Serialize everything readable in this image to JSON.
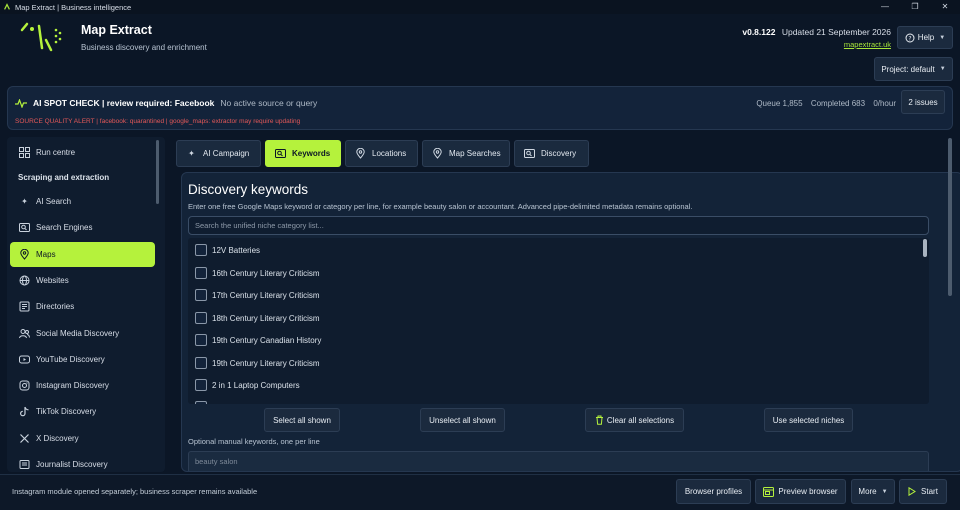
{
  "window": {
    "title": "Map Extract | Business intelligence",
    "controls": [
      "—",
      "❐",
      "✕"
    ]
  },
  "header": {
    "app_name": "Map Extract",
    "tagline": "Business discovery and enrichment",
    "version": "v0.8.122",
    "updated": "Updated 21 September 2026",
    "link": "mapextract.uk",
    "help_label": "Help",
    "project_label": "Project: default"
  },
  "alert": {
    "title": "AI SPOT CHECK | review required: Facebook",
    "status": "No active source or query",
    "quality": "SOURCE QUALITY ALERT | facebook: quarantined | google_maps: extractor may require updating",
    "queue": "Queue 1,855",
    "completed": "Completed 683",
    "rate": "0/hour",
    "issues_label": "2 issues"
  },
  "sidebar": {
    "run_centre": "Run centre",
    "section": "Scraping and extraction",
    "items": [
      {
        "label": "AI Search",
        "icon": "sparkle-icon"
      },
      {
        "label": "Search Engines",
        "icon": "search-engine-icon"
      },
      {
        "label": "Maps",
        "icon": "map-pin-icon",
        "active": true
      },
      {
        "label": "Websites",
        "icon": "globe-icon"
      },
      {
        "label": "Directories",
        "icon": "directory-icon"
      },
      {
        "label": "Social Media Discovery",
        "icon": "people-icon"
      },
      {
        "label": "YouTube Discovery",
        "icon": "youtube-icon"
      },
      {
        "label": "Instagram Discovery",
        "icon": "instagram-icon"
      },
      {
        "label": "TikTok Discovery",
        "icon": "tiktok-icon"
      },
      {
        "label": "X Discovery",
        "icon": "x-icon"
      },
      {
        "label": "Journalist Discovery",
        "icon": "journalist-icon"
      }
    ]
  },
  "tabs": [
    {
      "label": "AI Campaign",
      "icon": "sparkle-icon"
    },
    {
      "label": "Keywords",
      "icon": "keywords-icon",
      "active": true
    },
    {
      "label": "Locations",
      "icon": "map-pin-icon"
    },
    {
      "label": "Map Searches",
      "icon": "map-pin-icon"
    },
    {
      "label": "Discovery",
      "icon": "discovery-icon"
    }
  ],
  "keywords": {
    "title": "Discovery keywords",
    "description": "Enter one free Google Maps keyword or category per line, for example beauty salon or accountant. Advanced pipe-delimited metadata remains optional.",
    "search_placeholder": "Search the unified niche category list...",
    "items": [
      "12V Batteries",
      "16th Century Literary Criticism",
      "17th Century Literary Criticism",
      "18th Century Literary Criticism",
      "19th Century Canadian History",
      "19th Century Literary Criticism",
      "2 in 1 Laptop Computers"
    ],
    "select_all": "Select all shown",
    "unselect_all": "Unselect all shown",
    "clear_all": "Clear all selections",
    "use_selected": "Use selected niches",
    "manual_label": "Optional manual keywords, one per line",
    "manual_placeholder": "beauty salon"
  },
  "statusbar": {
    "message": "Instagram module opened separately; business scraper remains available",
    "browser_profiles": "Browser profiles",
    "preview_browser": "Preview browser",
    "more": "More",
    "start": "Start"
  },
  "colors": {
    "accent": "#b5f23c",
    "background": "#0b1626",
    "panel": "#132338",
    "alert_red": "#e35858"
  }
}
